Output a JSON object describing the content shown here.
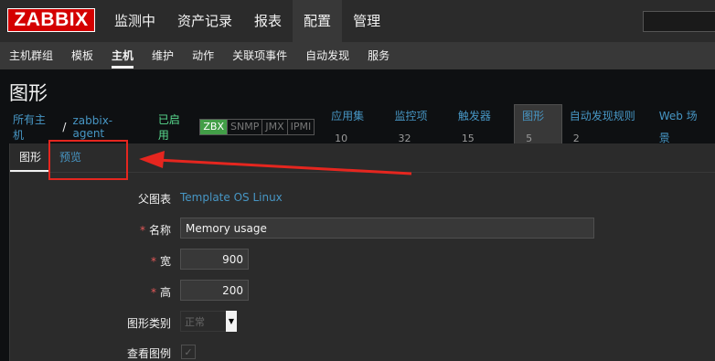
{
  "header": {
    "logo": "ZABBIX",
    "main_menu": [
      "监测中",
      "资产记录",
      "报表",
      "配置",
      "管理"
    ],
    "active_main": 3
  },
  "subnav": {
    "items": [
      "主机群组",
      "模板",
      "主机",
      "维护",
      "动作",
      "关联项事件",
      "自动发现",
      "服务"
    ],
    "active": 2
  },
  "page": {
    "title": "图形"
  },
  "breadcrumb": {
    "all_hosts": "所有主机",
    "separator": "/",
    "host": "zabbix-agent",
    "status": "已启用",
    "badges": [
      "ZBX",
      "SNMP",
      "JMX",
      "IPMI"
    ],
    "tabs": [
      {
        "label": "应用集",
        "count": "10"
      },
      {
        "label": "监控项",
        "count": "32"
      },
      {
        "label": "触发器",
        "count": "15"
      },
      {
        "label": "图形",
        "count": "5"
      },
      {
        "label": "自动发现规则",
        "count": "2"
      },
      {
        "label": "Web 场景",
        "count": ""
      }
    ]
  },
  "form": {
    "tabs": [
      "图形",
      "预览"
    ],
    "parent_label": "父图表",
    "parent_value": "Template OS Linux",
    "name_label": "名称",
    "name_value": "Memory usage",
    "width_label": "宽",
    "width_value": "900",
    "height_label": "高",
    "height_value": "200",
    "type_label": "图形类别",
    "type_value": "正常",
    "legend_label": "查看图例",
    "required_mark": "*"
  },
  "annotation": {
    "color": "#e5261f"
  }
}
